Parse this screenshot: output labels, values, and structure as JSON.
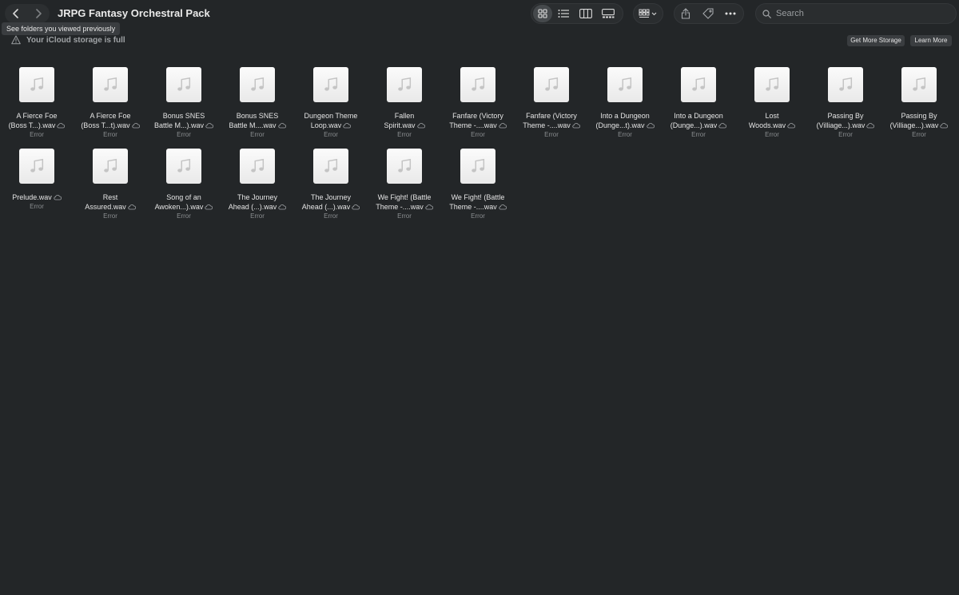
{
  "window": {
    "title": "JRPG Fantasy Orchestral Pack",
    "tooltip": "See folders you viewed previously"
  },
  "search": {
    "placeholder": "Search"
  },
  "banner": {
    "message": "Your iCloud storage is full",
    "get_more_label": "Get More Storage",
    "learn_more_label": "Learn More"
  },
  "files": [
    {
      "line1": "A Fierce Foe",
      "line2": "(Boss T...).wav",
      "status": "Error"
    },
    {
      "line1": "A Fierce Foe",
      "line2": "(Boss T...t).wav",
      "status": "Error"
    },
    {
      "line1": "Bonus SNES",
      "line2": "Battle M...).wav",
      "status": "Error"
    },
    {
      "line1": "Bonus SNES",
      "line2": "Battle M....wav",
      "status": "Error"
    },
    {
      "line1": "Dungeon Theme",
      "line2": "Loop.wav",
      "status": "Error"
    },
    {
      "line1": "Fallen",
      "line2": "Spirit.wav",
      "status": "Error"
    },
    {
      "line1": "Fanfare (Victory",
      "line2": "Theme -....wav",
      "status": "Error"
    },
    {
      "line1": "Fanfare (Victory",
      "line2": "Theme -....wav",
      "status": "Error"
    },
    {
      "line1": "Into a Dungeon",
      "line2": "(Dunge...t).wav",
      "status": "Error"
    },
    {
      "line1": "Into a Dungeon",
      "line2": "(Dunge...).wav",
      "status": "Error"
    },
    {
      "line1": "Lost",
      "line2": "Woods.wav",
      "status": "Error"
    },
    {
      "line1": "Passing By",
      "line2": "(Villiage...).wav",
      "status": "Error"
    },
    {
      "line1": "Passing By",
      "line2": "(Villiage...).wav",
      "status": "Error"
    },
    {
      "line1": "",
      "line2": "Prelude.wav",
      "status": "Error"
    },
    {
      "line1": "Rest",
      "line2": "Assured.wav",
      "status": "Error"
    },
    {
      "line1": "Song of an",
      "line2": "Awoken...).wav",
      "status": "Error"
    },
    {
      "line1": "The Journey",
      "line2": "Ahead (...).wav",
      "status": "Error"
    },
    {
      "line1": "The Journey",
      "line2": "Ahead (...).wav",
      "status": "Error"
    },
    {
      "line1": "We Fight! (Battle",
      "line2": "Theme -....wav",
      "status": "Error"
    },
    {
      "line1": "We Fight! (Battle",
      "line2": "Theme -....wav",
      "status": "Error"
    }
  ]
}
